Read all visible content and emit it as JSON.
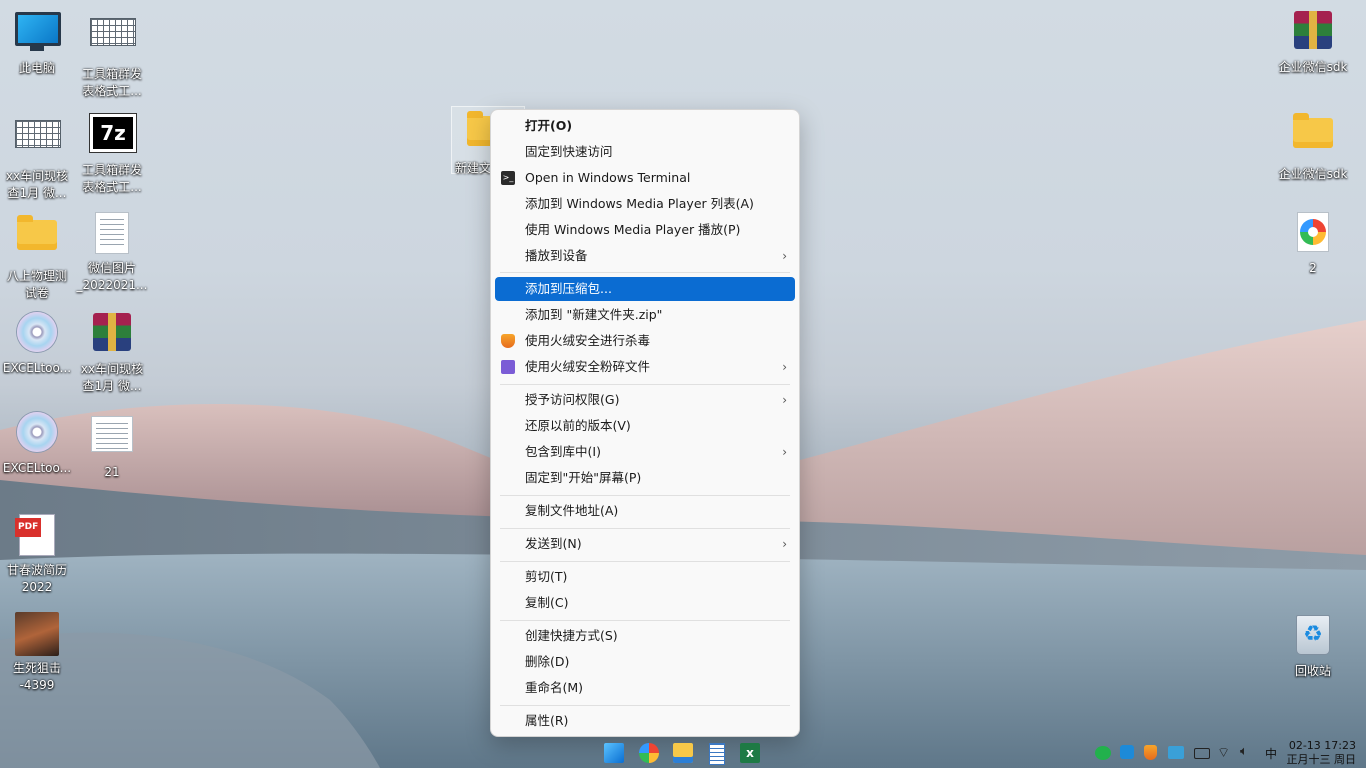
{
  "desktop": {
    "icons_left": [
      {
        "label": "此电脑",
        "icon": "computer-icon"
      },
      {
        "label": "工具箱群发\n表格式工...",
        "icon": "spreadsheet-icon"
      },
      {
        "label": "xx车间现核\n查1月 微...",
        "icon": "spreadsheet-icon"
      },
      {
        "label": "工具箱群发\n表格式工...",
        "icon": "7z-archive-icon"
      },
      {
        "label": "八上物理测\n试卷",
        "icon": "folder-icon"
      },
      {
        "label": "微信图片\n_2022021...",
        "icon": "document-icon"
      },
      {
        "label": "EXCELtoo...",
        "icon": "cd-installer-icon"
      },
      {
        "label": "xx车间现核\n查1月 微...",
        "icon": "winrar-icon"
      },
      {
        "label": "EXCELtoo...",
        "icon": "cd-installer-icon"
      },
      {
        "label": "21",
        "icon": "screenshot-icon"
      },
      {
        "label": "甘春波简历\n2022",
        "icon": "pdf-icon"
      },
      {
        "label": "生死狙击\n-4399",
        "icon": "game-icon"
      }
    ],
    "selected_folder_label": "新建文",
    "icons_right": [
      {
        "label": "企业微信sdk",
        "icon": "winrar-icon"
      },
      {
        "label": "企业微信sdk",
        "icon": "folder-icon"
      },
      {
        "label": "2",
        "icon": "image-file-icon"
      },
      {
        "label": "回收站",
        "icon": "recycle-bin-icon"
      }
    ]
  },
  "context_menu": {
    "items": [
      {
        "label": "打开(O)"
      },
      {
        "label": "固定到快速访问"
      },
      {
        "label": "Open in Windows Terminal"
      },
      {
        "label": "添加到 Windows Media Player 列表(A)"
      },
      {
        "label": "使用 Windows Media Player 播放(P)"
      },
      {
        "label": "播放到设备"
      },
      {
        "label": "添加到压缩包..."
      },
      {
        "label": "添加到 \"新建文件夹.zip\""
      },
      {
        "label": "使用火绒安全进行杀毒"
      },
      {
        "label": "使用火绒安全粉碎文件"
      },
      {
        "label": "授予访问权限(G)"
      },
      {
        "label": "还原以前的版本(V)"
      },
      {
        "label": "包含到库中(I)"
      },
      {
        "label": "固定到\"开始\"屏幕(P)"
      },
      {
        "label": "复制文件地址(A)"
      },
      {
        "label": "发送到(N)"
      },
      {
        "label": "剪切(T)"
      },
      {
        "label": "复制(C)"
      },
      {
        "label": "创建快捷方式(S)"
      },
      {
        "label": "删除(D)"
      },
      {
        "label": "重命名(M)"
      },
      {
        "label": "属性(R)"
      }
    ],
    "highlighted": "添加到压缩包...",
    "submenu_arrow": "›"
  },
  "taskbar": {
    "apps": [
      "start-icon",
      "browser-icon",
      "file-explorer-icon",
      "notepad-icon",
      "excel-icon"
    ],
    "ime": "中",
    "date_time": "02-13 17:23",
    "lunar_date": "正月十三 周日"
  },
  "colors": {
    "highlight": "#0b6cd2",
    "menu_bg": "#f9f9f9"
  }
}
